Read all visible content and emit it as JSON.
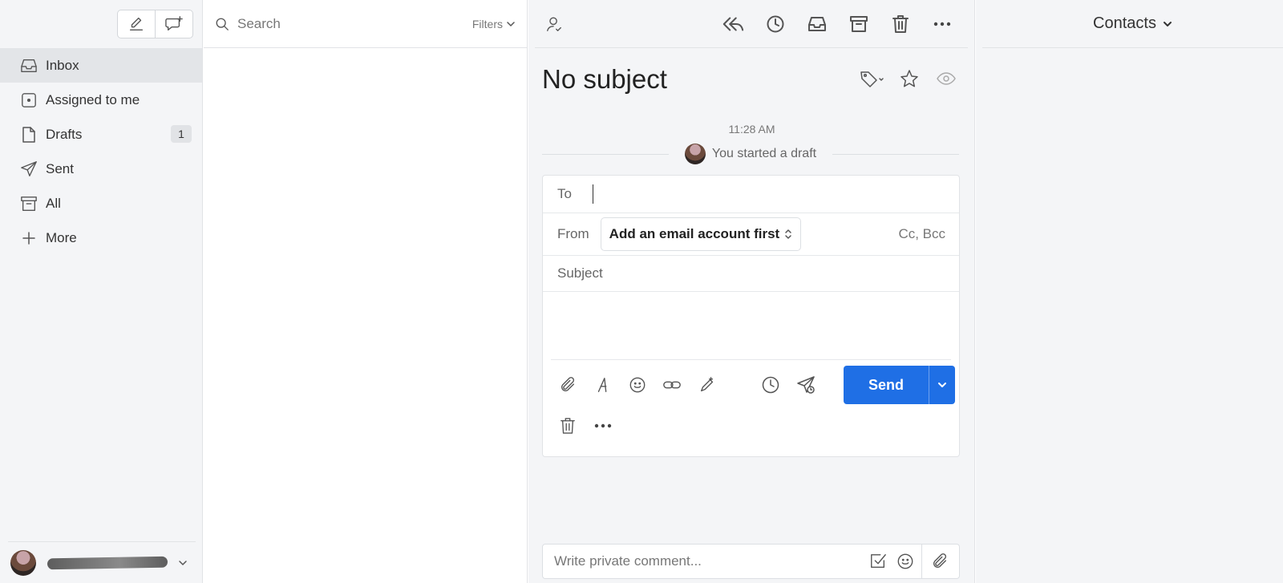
{
  "sidebar": {
    "items": [
      {
        "label": "Inbox",
        "icon": "inbox-icon"
      },
      {
        "label": "Assigned to me",
        "icon": "assigned-icon"
      },
      {
        "label": "Drafts",
        "icon": "file-icon",
        "badge": "1"
      },
      {
        "label": "Sent",
        "icon": "send-plane-icon"
      },
      {
        "label": "All",
        "icon": "archive-box-icon"
      },
      {
        "label": "More",
        "icon": "plus-icon"
      }
    ]
  },
  "search": {
    "placeholder": "Search",
    "filters_label": "Filters"
  },
  "conversation": {
    "title": "No subject",
    "time": "11:28 AM",
    "event": "You started a draft"
  },
  "composer": {
    "to_label": "To",
    "from_label": "From",
    "from_value": "Add an email account first",
    "cc_bcc": "Cc, Bcc",
    "subject_placeholder": "Subject",
    "send_label": "Send"
  },
  "comment": {
    "placeholder": "Write private comment..."
  },
  "contacts": {
    "title": "Contacts"
  },
  "colors": {
    "accent": "#1f6fe5",
    "sidebar_bg": "#f4f5f7"
  }
}
